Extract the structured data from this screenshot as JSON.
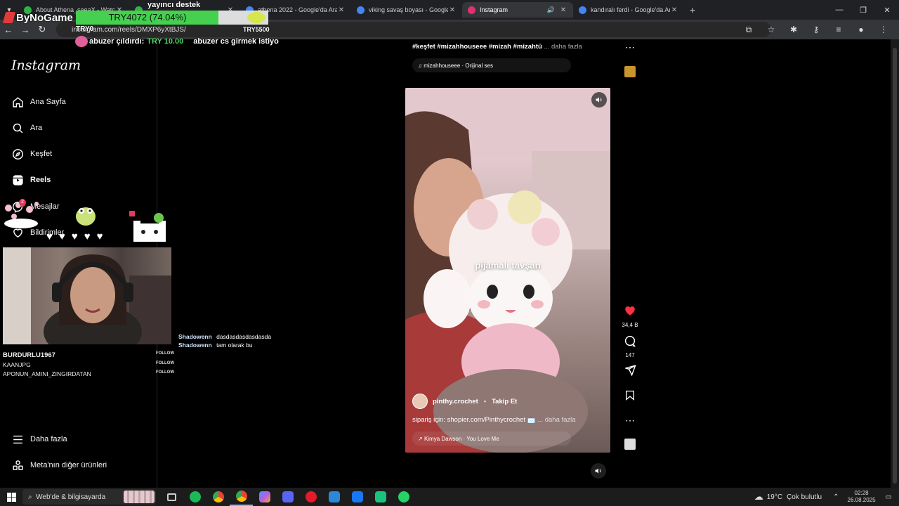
{
  "browser": {
    "tabs": [
      {
        "title": "About Athena_seeaX - Watch i",
        "icon_color": "#2fb344",
        "active": false
      },
      {
        "title": "",
        "icon_color": "#2fb344",
        "active": false
      },
      {
        "title": "athena 2022 - Google'da Ara",
        "icon_color": "#4285f4",
        "active": false
      },
      {
        "title": "viking savaş boyası - Google'da",
        "icon_color": "#4285f4",
        "active": false
      },
      {
        "title": "Instagram",
        "icon_color": "#e1306c",
        "active": true
      },
      {
        "title": "kandıralı ferdi - Google'da Ara",
        "icon_color": "#4285f4",
        "active": false
      }
    ],
    "url": "instagram.com/reels/DMXP6yXtBJS/"
  },
  "stream_overlay": {
    "brand": "ByNoGame",
    "goal_title": "yayıncı destek",
    "goal_amount_text": "TRY4072 (74.04%)",
    "goal_progress_percent": 74.04,
    "goal_left": "TRY0",
    "goal_right": "TRY5500",
    "alert_name": "abuzer çıldırdı:",
    "alert_amount": "TRY 10.00",
    "alert_message": "abuzer cs girmek istiyo",
    "followers": [
      {
        "name": "BURDURLU1967",
        "button": "FOLLOW"
      },
      {
        "name": "KAANJPG",
        "button": "FOLLOW"
      },
      {
        "name": "APONUN_AMINI_ZINGIRDATAN",
        "button": "FOLLOW"
      }
    ],
    "chat": [
      {
        "user": "Shadowenn",
        "message": "dasdasdasdasdasda"
      },
      {
        "user": "Shadowenn",
        "message": "tam olarak bu"
      }
    ],
    "badge_count": "2"
  },
  "instagram": {
    "logo": "Instagram",
    "nav": [
      {
        "label": "Ana Sayfa",
        "icon": "home-icon"
      },
      {
        "label": "Ara",
        "icon": "search-icon"
      },
      {
        "label": "Keşfet",
        "icon": "compass-icon"
      },
      {
        "label": "Reels",
        "icon": "reels-icon"
      },
      {
        "label": "Mesajlar",
        "icon": "messenger-icon"
      },
      {
        "label": "Bildirimler",
        "icon": "heart-icon"
      }
    ],
    "nav_bottom": [
      {
        "label": "Daha fazla",
        "icon": "menu-icon"
      },
      {
        "label": "Meta'nın diğer ürünleri",
        "icon": "meta-icon"
      }
    ],
    "prev_reel": {
      "caption": "#keşfet #mizahhouseee #mizah #mizahtü",
      "more": "... daha fazla",
      "music": "mizahhouseee · Orijinal ses"
    },
    "reel": {
      "overlay_text": "pijamalı tavşan",
      "author": "pinthy.crochet",
      "follow": "Takip Et",
      "caption": "sipariş için: shopier.com/Pinthycrochet 📩",
      "more": "... daha fazla",
      "music": "Kimya Dawson · You Love Me",
      "likes": "34,4 B",
      "comments": "147"
    }
  },
  "taskbar": {
    "search_placeholder": "Web'de & bilgisayarda",
    "weather_temp": "19°C",
    "weather_text": "Çok bulutlu",
    "time": "02:28",
    "date": "26.08.2025"
  },
  "colors": {
    "chrome_dark": "#202124",
    "progress_green": "#45d14f",
    "like_red": "#ff3040",
    "accent_blue": "#8ab4f8"
  }
}
